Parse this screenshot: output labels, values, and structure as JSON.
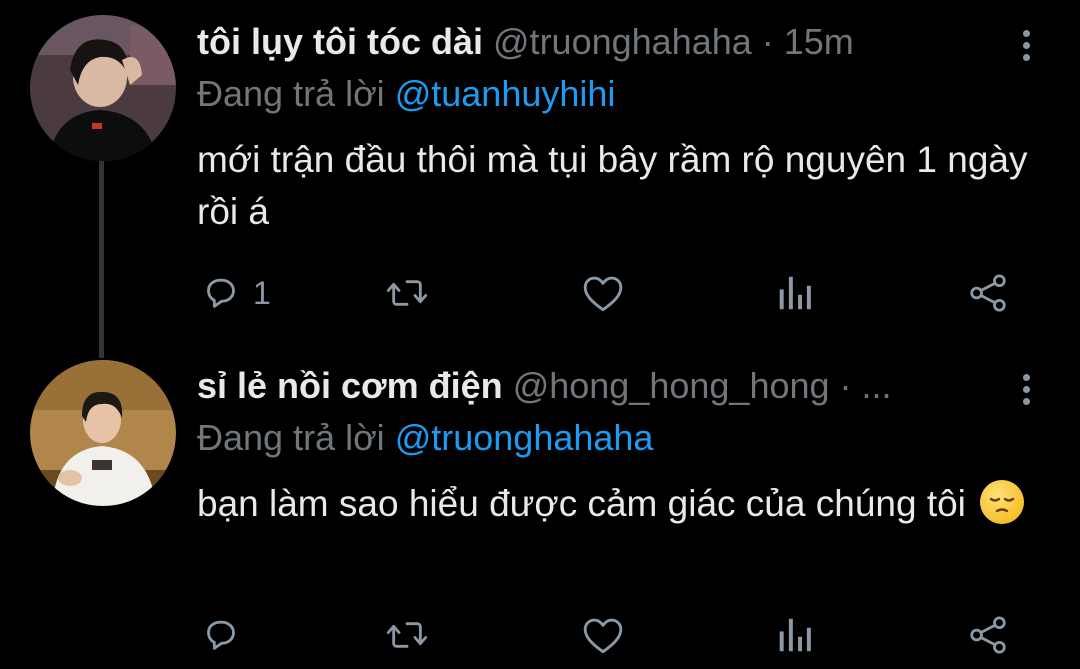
{
  "tweets": [
    {
      "author_name": "tôi lụy tôi tóc dài",
      "handle_meta": "@truonghahaha · 15m",
      "reply_prefix": "Đang trả lời",
      "reply_to": "@tuanhuyhihi",
      "body": "mới trận đầu thôi mà tụi bây rầm rộ nguyên 1 ngày rồi á",
      "reply_count": "1",
      "avatar_colors": {
        "bg": "#5a4a50",
        "skin": "#d9b8a4",
        "hair": "#1a1616",
        "shirt": "#0c0c0c"
      }
    },
    {
      "author_name": "sỉ lẻ nồi cơm điện",
      "handle_meta": "@hong_hong_hong · ...",
      "reply_prefix": "Đang trả lời",
      "reply_to": "@truonghahaha",
      "body": "bạn làm sao hiểu được cảm giác của chúng tôi",
      "emoji": "pensive-face",
      "reply_count": "",
      "avatar_colors": {
        "bg": "#b58a4e",
        "skin": "#e6c3a6",
        "hair": "#1c1814",
        "shirt": "#f2f0ec"
      }
    }
  ],
  "icons": {
    "reply": "reply-icon",
    "retweet": "retweet-icon",
    "like": "heart-icon",
    "views": "analytics-icon",
    "share": "share-icon",
    "more": "more-vertical-icon"
  },
  "colors": {
    "background": "#000000",
    "text": "#e7e9ea",
    "muted": "#71767b",
    "accent": "#1d9bf0"
  }
}
